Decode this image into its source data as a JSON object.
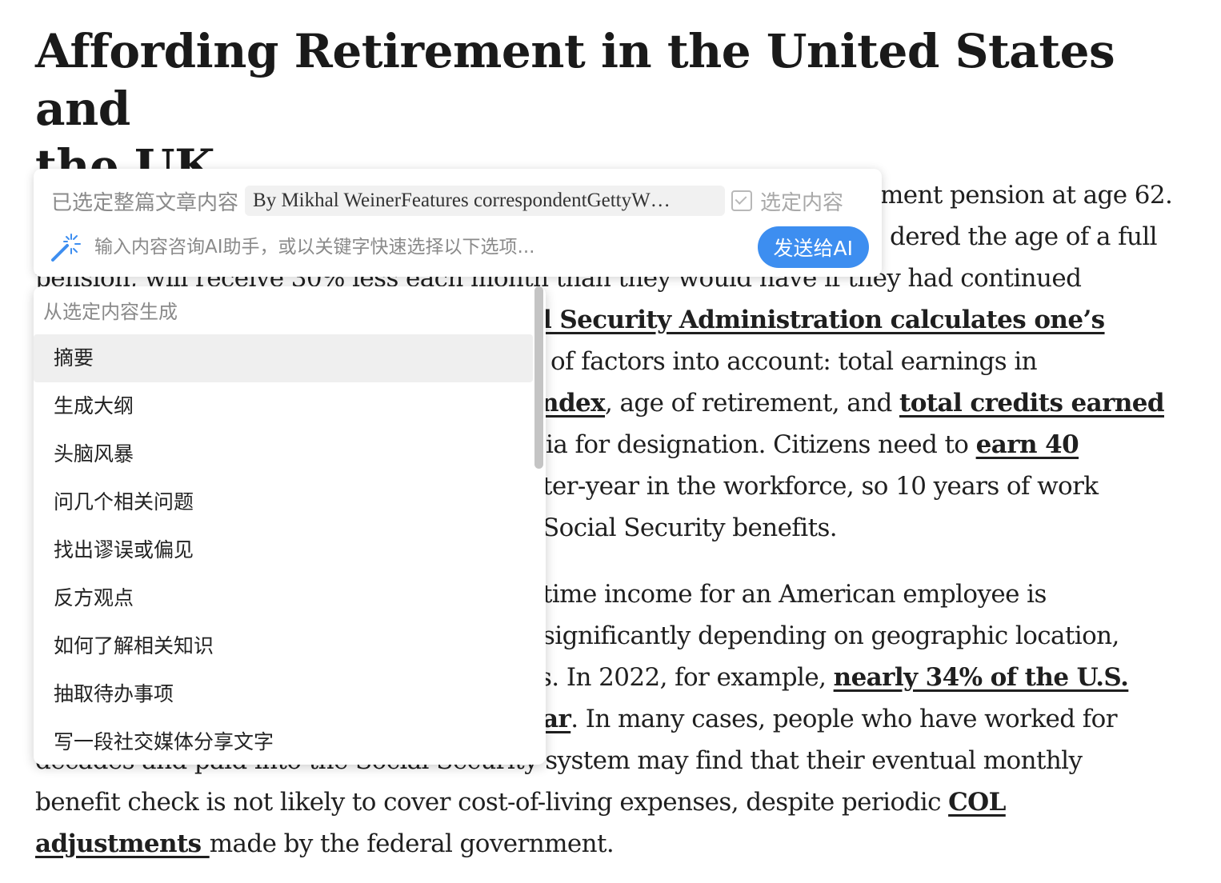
{
  "article": {
    "title_line1": "Affording Retirement in the United States and",
    "title_line2": "the UK",
    "lines": [
      [
        {
          "t": "ment pension at age 62."
        }
      ],
      [
        {
          "t": "dered the age of a full"
        }
      ],
      [
        {
          "t": "pension, will receive 30% less each month than they would have if they had continued"
        }
      ],
      [
        {
          "t": "l Security Administration calculates one’s",
          "link": true
        }
      ],
      [
        {
          "t": "of factors into account: total earnings in"
        }
      ],
      [
        {
          "t": "ndex",
          "link": true
        },
        {
          "t": ", age of retirement, and "
        },
        {
          "t": "total credits earned",
          "link": true
        }
      ],
      [
        {
          "t": "ia for designation. Citizens need to "
        },
        {
          "t": "earn 40",
          "link": true
        }
      ],
      [
        {
          "t": "ter-year in the workforce, so 10 years of work"
        }
      ],
      [
        {
          "t": "Social Security benefits."
        }
      ],
      [
        {
          "t": "time income for an American employee is"
        }
      ],
      [
        {
          "t": "significantly depending on geographic location,"
        }
      ],
      [
        {
          "t": "s. In 2022, for example, "
        },
        {
          "t": "nearly 34% of the U.S.",
          "link": true
        }
      ],
      [
        {
          "t": "ar",
          "link": true
        },
        {
          "t": ". In many cases, people who have worked for"
        }
      ],
      [
        {
          "t": "decades and paid into the Social Security system may find that their eventual monthly"
        }
      ],
      [
        {
          "t": "benefit check is not likely to cover cost-of-living expenses, despite periodic "
        },
        {
          "t": "COL",
          "link": true
        }
      ],
      [
        {
          "t": "adjustments ",
          "link": true
        },
        {
          "t": "made by the federal government."
        }
      ]
    ]
  },
  "ai_bar": {
    "selected_label": "已选定整篇文章内容",
    "selected_preview": "By Mikhal WeinerFeatures correspondentGettyW…",
    "select_option": "选定内容",
    "input_placeholder": "输入内容咨询AI助手，或以关键字快速选择以下选项...",
    "send_label": "发送给AI",
    "accent": "#3d8ef0"
  },
  "menu": {
    "header": "从选定内容生成",
    "items": [
      "摘要",
      "生成大纲",
      "头脑风暴",
      "问几个相关问题",
      "找出谬误或偏见",
      "反方观点",
      "如何了解相关知识",
      "抽取待办事项",
      "写一段社交媒体分享文字"
    ],
    "active_index": 0
  }
}
